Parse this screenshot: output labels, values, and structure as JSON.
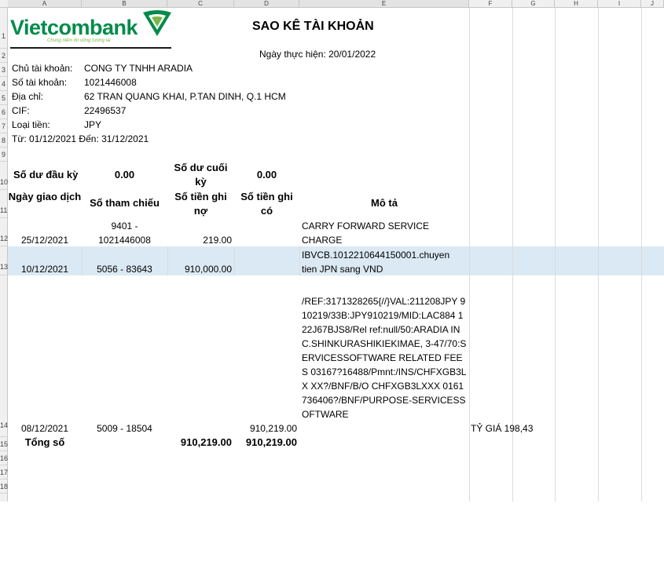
{
  "columns": [
    "A",
    "B",
    "C",
    "D",
    "E",
    "F",
    "G",
    "H",
    "I",
    "J"
  ],
  "rows": [
    "1",
    "2",
    "3",
    "4",
    "5",
    "6",
    "7",
    "8",
    "9",
    "10",
    "11",
    "12",
    "13",
    "14",
    "15",
    "16",
    "17",
    "18"
  ],
  "brand": {
    "name": "Vietcombank",
    "tagline": "Chung niềm tin vững tương lai",
    "color": "#008b4a"
  },
  "header": {
    "title": "SAO KÊ TÀI KHOẢN",
    "date_label": "Ngày thực hiện: 20/01/2022"
  },
  "account": {
    "owner_label": "Chủ tài khoản:",
    "owner": "CONG TY TNHH ARADIA",
    "number_label": "Số tài khoản:",
    "number": "1021446008",
    "address_label": "Địa chỉ:",
    "address": "62 TRAN QUANG KHAI, P.TAN DINH, Q.1 HCM",
    "cif_label": "CIF:",
    "cif": "22496537",
    "currency_label": "Loại tiền:",
    "currency": "JPY",
    "period": "Từ: 01/12/2021 Đến: 31/12/2021"
  },
  "balances": {
    "opening_label": "Số dư đầu kỳ",
    "opening": "0.00",
    "closing_label": "Số dư cuối kỳ",
    "closing": "0.00"
  },
  "table": {
    "headers": {
      "date": "Ngày giao dịch",
      "ref": "Số tham chiếu",
      "debit": "Số tiền ghi nợ",
      "credit": "Số tiền ghi có",
      "desc": "Mô tả"
    },
    "rows": [
      {
        "date": "25/12/2021",
        "ref": "9401 - 1021446008",
        "debit": "219.00",
        "credit": "",
        "desc": "CARRY FORWARD SERVICE CHARGE",
        "note": ""
      },
      {
        "date": "10/12/2021",
        "ref": "5056 - 83643",
        "debit": "910,000.00",
        "credit": "",
        "desc": "IBVCB.1012210644150001.chuyen tien JPN sang VND",
        "note": ""
      },
      {
        "date": "08/12/2021",
        "ref": "5009 - 18504",
        "debit": "",
        "credit": "910,219.00",
        "desc": "/REF:3171328265{//}VAL:211208JPY 910219/33B:JPY910219/MID:LAC884 122J67BJS8/Rel ref:null/50:ARADIA INC.SHINKURASHIKIEKIMAE, 3-47/70:SERVICESSOFTWARE RELATED FEES 03167?16488/Pmnt:/INS/CHFXGB3LX XX?/BNF/B/O CHFXGB3LXXX 0161736406?/BNF/PURPOSE-SERVICESSOFTWARE",
        "note": "TỶ GIÁ 198,43"
      }
    ],
    "total_label": "Tổng số",
    "total_debit": "910,219.00",
    "total_credit": "910,219.00"
  },
  "colors": {
    "selected_band": "#dbe9f4",
    "gridline": "#dadcdd"
  }
}
